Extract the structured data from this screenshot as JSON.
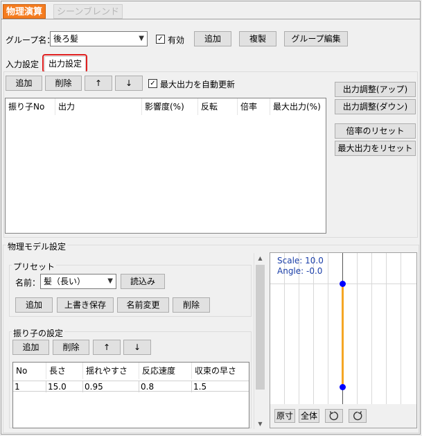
{
  "tabs": {
    "physics": "物理演算",
    "scene_blend": "シーンブレンド"
  },
  "group": {
    "label": "グループ名：",
    "selected": "後ろ髪",
    "enabled_checkbox": "✓",
    "enabled_label": "有効",
    "add": "追加",
    "duplicate": "複製",
    "edit": "グループ編集"
  },
  "subtabs": {
    "input": "入力設定",
    "output": "出力設定"
  },
  "output_toolbar": {
    "add": "追加",
    "delete": "削除",
    "up": "↑",
    "down": "↓",
    "auto_update_check": "✓",
    "auto_update_label": "最大出力を自動更新"
  },
  "output_table": {
    "columns": [
      "振り子No",
      "出力",
      "影響度(%)",
      "反転",
      "倍率",
      "最大出力(%)"
    ]
  },
  "side_buttons": {
    "up": "出力調整(アップ)",
    "down": "出力調整(ダウン)",
    "reset_scale": "倍率のリセット",
    "reset_max": "最大出力をリセット"
  },
  "model": {
    "title": "物理モデル設定",
    "preset_title": "プリセット",
    "name_label": "名前：",
    "name_selected": "髪（長い）",
    "load": "読込み",
    "add": "追加",
    "overwrite": "上書き保存",
    "rename": "名前変更",
    "delete": "削除"
  },
  "pendulum": {
    "title": "振り子の設定",
    "add": "追加",
    "delete": "削除",
    "up": "↑",
    "down": "↓",
    "columns": [
      "No",
      "長さ",
      "揺れやすさ",
      "反応速度",
      "収束の早さ"
    ],
    "rows": [
      [
        "1",
        "15.0",
        "0.95",
        "0.8",
        "1.5"
      ]
    ]
  },
  "preview": {
    "scale": "Scale: 10.0",
    "angle": "Angle: -0.0",
    "actual_size": "原寸",
    "fit_all": "全体",
    "rotate_left_icon": "rotate-ccw-icon",
    "rotate_right_icon": "rotate-cw-icon",
    "pendulum_color": "#f5a623",
    "node_color": "#0000ff"
  },
  "colors": {
    "accent": "#f57c1f",
    "highlight": "#e02020"
  }
}
